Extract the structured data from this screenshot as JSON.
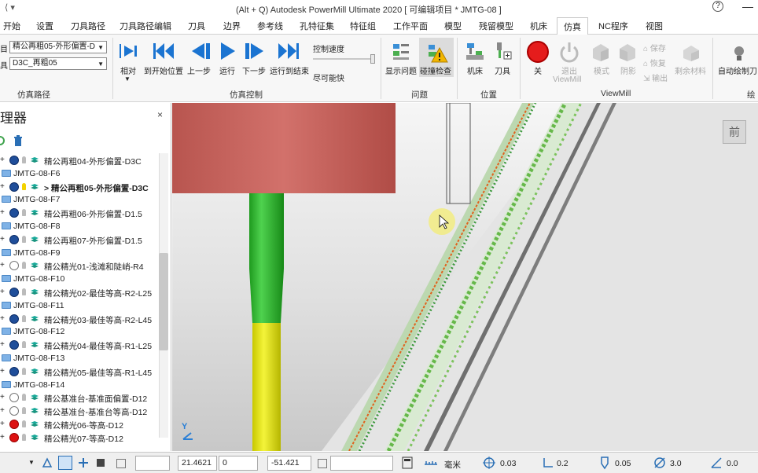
{
  "titlebar": {
    "quick_access": "⟨ ▾",
    "title": "(Alt + Q) Autodesk PowerMill Ultimate 2020    [ 可编辑项目 * JMTG-08 ]",
    "help": "?"
  },
  "menu_tabs": [
    {
      "label": "开始"
    },
    {
      "label": "设置"
    },
    {
      "label": "刀具路径"
    },
    {
      "label": "刀具路径编辑"
    },
    {
      "label": "刀具"
    },
    {
      "label": "边界"
    },
    {
      "label": "参考线"
    },
    {
      "label": "孔特征集"
    },
    {
      "label": "特征组"
    },
    {
      "label": "工作平面"
    },
    {
      "label": "模型"
    },
    {
      "label": "残留模型"
    },
    {
      "label": "机床"
    },
    {
      "label": "仿真",
      "active": true
    },
    {
      "label": "NC程序"
    },
    {
      "label": "视图"
    }
  ],
  "ribbon": {
    "sim_path": {
      "row1_prefix": "目",
      "toolpath_value": "精公再粗05-外形偏置-D",
      "row2_prefix": "具",
      "tool_value": "D3C_再粗05",
      "group_label": "仿真路径"
    },
    "sim_control": {
      "buttons": [
        "相对",
        "到开始位置",
        "上一步",
        "运行",
        "下一步",
        "运行到结束"
      ],
      "speed_label": "控制速度",
      "speed_value": "尽可能快",
      "group_label": "仿真控制"
    },
    "issues": {
      "buttons": [
        "显示问题",
        "碰撞检查"
      ],
      "group_label": "问题"
    },
    "position": {
      "buttons": [
        "机床",
        "刀具"
      ],
      "group_label": "位置"
    },
    "viewmill": {
      "off_label": "关",
      "exit_label": "退出",
      "exit_label2": "ViewMill",
      "mode_label": "模式",
      "shade_label": "阴影",
      "save_label": "保存",
      "restore_label": "恢复",
      "export_label": "输出",
      "remaining_label": "剩余材料",
      "group_label": "ViewMill"
    },
    "draw": {
      "button": "自动绘制刀",
      "group_label": "绘"
    }
  },
  "explorer": {
    "title": "理器",
    "close": "×",
    "rows": [
      {
        "type": "path",
        "status": "blue",
        "label": "精公再粗04-外形偏置-D3C"
      },
      {
        "type": "folder",
        "label": "JMTG-08-F6"
      },
      {
        "type": "path",
        "status": "blue",
        "label": "> 精公再粗05-外形偏置-D3C",
        "active": true
      },
      {
        "type": "folder",
        "label": "JMTG-08-F7"
      },
      {
        "type": "path",
        "status": "blue",
        "label": "精公再粗06-外形偏置-D1.5"
      },
      {
        "type": "folder",
        "label": "JMTG-08-F8"
      },
      {
        "type": "path",
        "status": "blue",
        "label": "精公再粗07-外形偏置-D1.5"
      },
      {
        "type": "folder",
        "label": "JMTG-08-F9"
      },
      {
        "type": "path",
        "status": "grey",
        "label": "精公精光01-浅滩和陡峭-R4"
      },
      {
        "type": "folder",
        "label": "JMTG-08-F10"
      },
      {
        "type": "path",
        "status": "blue",
        "label": "精公精光02-最佳等高-R2-L25"
      },
      {
        "type": "folder",
        "label": "JMTG-08-F11"
      },
      {
        "type": "path",
        "status": "blue",
        "label": "精公精光03-最佳等高-R2-L45"
      },
      {
        "type": "folder",
        "label": "JMTG-08-F12"
      },
      {
        "type": "path",
        "status": "blue",
        "label": "精公精光04-最佳等高-R1-L25"
      },
      {
        "type": "folder",
        "label": "JMTG-08-F13"
      },
      {
        "type": "path",
        "status": "blue",
        "label": "精公精光05-最佳等高-R1-L45"
      },
      {
        "type": "folder",
        "label": "JMTG-08-F14"
      },
      {
        "type": "path",
        "status": "grey",
        "label": "精公基准台-基准面偏置-D12"
      },
      {
        "type": "path",
        "status": "grey",
        "label": "精公基准台-基准台等高-D12"
      },
      {
        "type": "path",
        "status": "red",
        "label": "精公精光06-等高-D12"
      },
      {
        "type": "path",
        "status": "red",
        "label": "精公精光07-等高-D12"
      }
    ]
  },
  "viewport": {
    "view_cube_label": "前",
    "triad_label": "Y"
  },
  "statusbar": {
    "x": "21.4621",
    "y": "0",
    "z": "-51.421",
    "units": "毫米",
    "tolerance": "0.03",
    "thickness": "0.2",
    "tool_diameter": "0.05",
    "diameter": "3.0",
    "angle": "0.0"
  }
}
